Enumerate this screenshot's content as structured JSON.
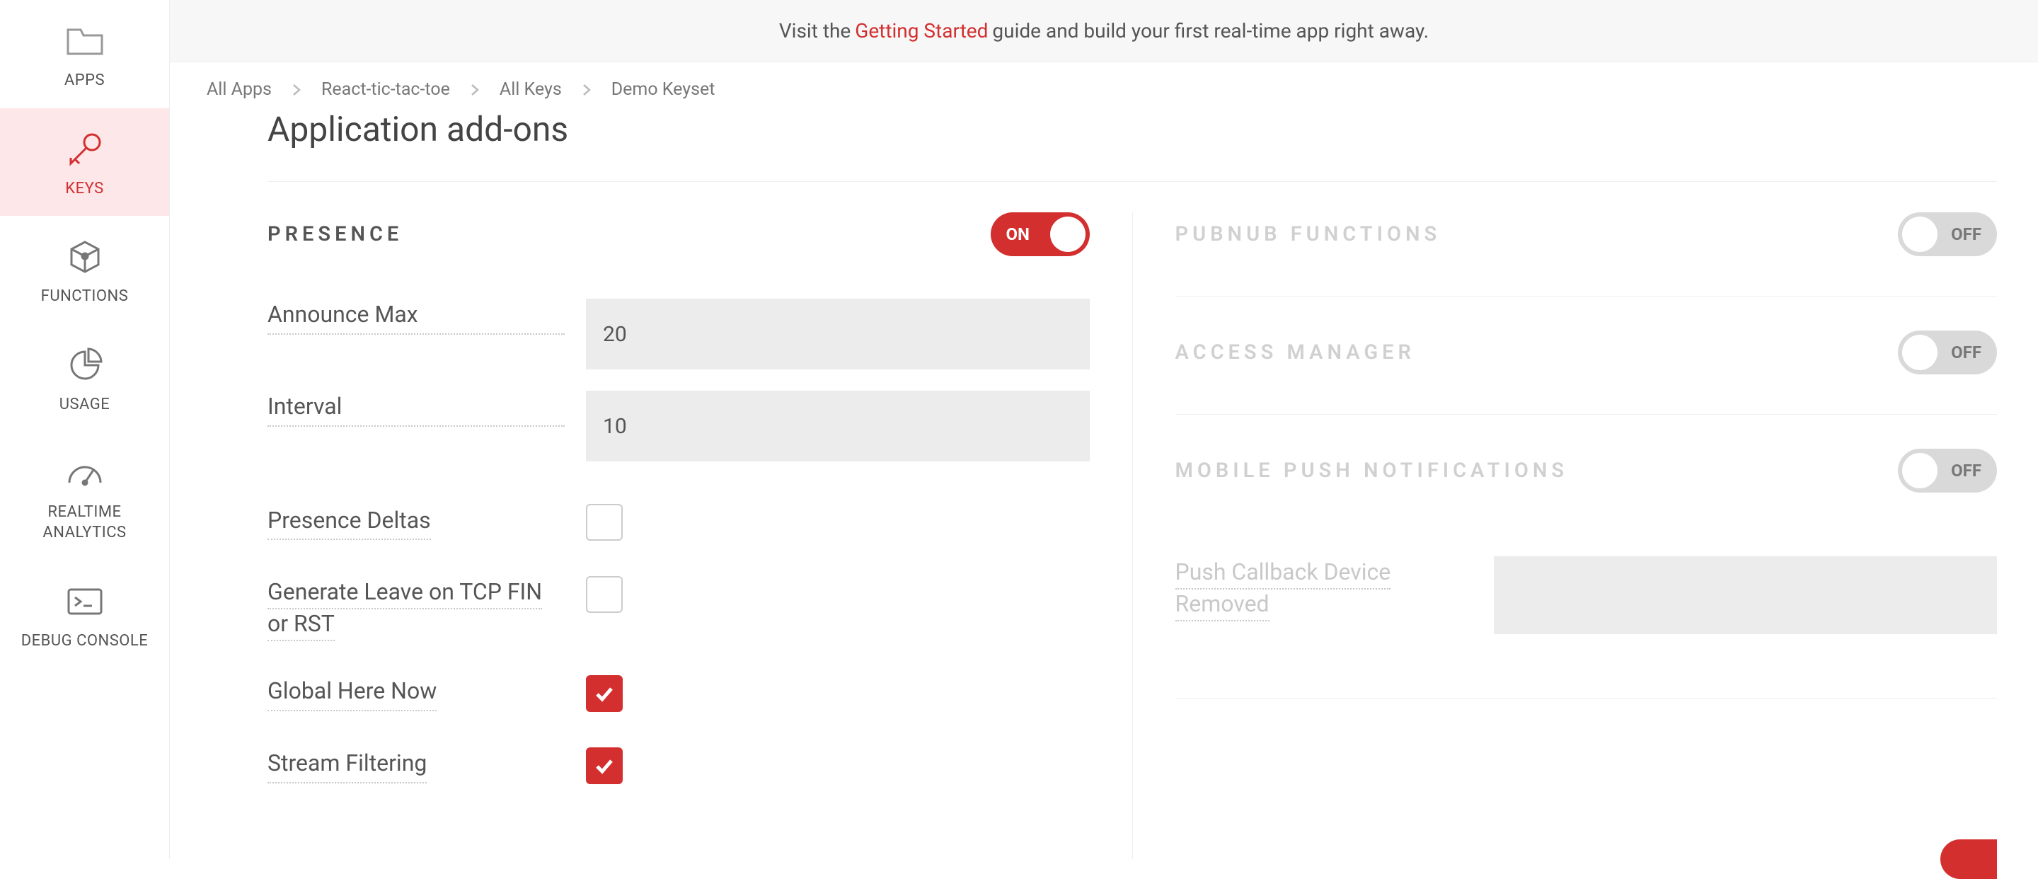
{
  "banner": {
    "before": "Visit the ",
    "link": "Getting Started",
    "after": " guide and build your first real-time app right away."
  },
  "breadcrumb": {
    "items": [
      "All Apps",
      "React-tic-tac-toe",
      "All Keys",
      "Demo Keyset"
    ]
  },
  "page": {
    "title": "Application add-ons"
  },
  "sidebar": {
    "items": [
      {
        "label": "APPS"
      },
      {
        "label": "KEYS"
      },
      {
        "label": "FUNCTIONS"
      },
      {
        "label": "USAGE"
      },
      {
        "label": "REALTIME ANALYTICS"
      },
      {
        "label": "DEBUG CONSOLE"
      }
    ]
  },
  "presence": {
    "title": "PRESENCE",
    "toggle": "ON",
    "announce_max_label": "Announce Max",
    "announce_max_value": "20",
    "interval_label": "Interval",
    "interval_value": "10",
    "deltas_label": "Presence Deltas",
    "tcp_fin_label": "Generate Leave on TCP FIN or RST",
    "global_here_now_label": "Global Here Now",
    "stream_filtering_label": "Stream Filtering"
  },
  "functions": {
    "title": "PUBNUB FUNCTIONS",
    "toggle": "OFF"
  },
  "access_mgr": {
    "title": "ACCESS MANAGER",
    "toggle": "OFF"
  },
  "mobile_push": {
    "title": "MOBILE PUSH NOTIFICATIONS",
    "toggle": "OFF",
    "callback_label": "Push Callback Device Removed",
    "callback_value": ""
  }
}
